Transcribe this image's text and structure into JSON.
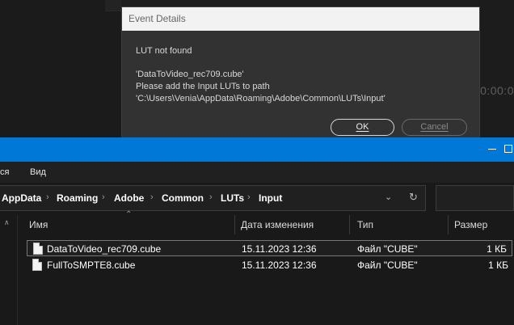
{
  "background_app": {
    "timecode": "0:00:0"
  },
  "dialog": {
    "title": "Event Details",
    "lines": [
      "LUT not found",
      "'DataToVideo_rec709.cube'",
      "Please add the Input LUTs to path",
      "'C:\\Users\\Venia\\AppData\\Roaming\\Adobe\\Common\\LUTs\\Input'"
    ],
    "ok_label": "OK",
    "cancel_label": "Cancel"
  },
  "explorer": {
    "menu": [
      "ся",
      "Вид"
    ],
    "breadcrumb": [
      "AppData",
      "Roaming",
      "Adobe",
      "Common",
      "LUTs",
      "Input"
    ],
    "columns": [
      "Имя",
      "Дата изменения",
      "Тип",
      "Размер"
    ],
    "files": [
      {
        "name": "DataToVideo_rec709.cube",
        "date": "15.11.2023 12:36",
        "type": "Файл \"CUBE\"",
        "size": "1 КБ"
      },
      {
        "name": "FullToSMPTE8.cube",
        "date": "15.11.2023 12:36",
        "type": "Файл \"CUBE\"",
        "size": "1 КБ"
      }
    ],
    "accent_color": "#0078d7"
  }
}
